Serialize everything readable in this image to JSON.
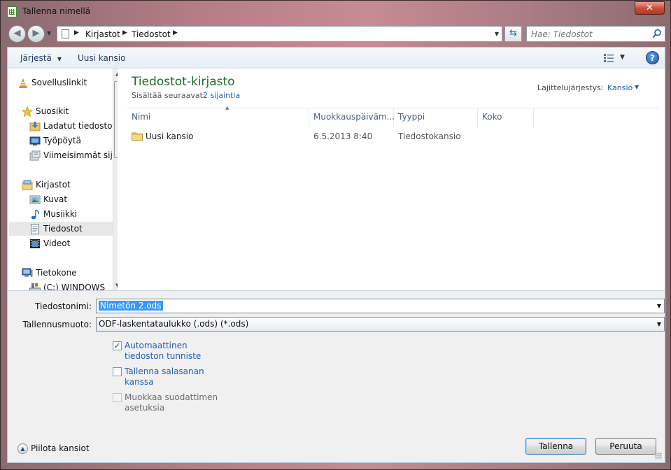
{
  "window": {
    "title": "Tallenna nimellä",
    "close_label": "✕"
  },
  "address": {
    "crumbs": [
      "Kirjastot",
      "Tiedostot"
    ],
    "search_placeholder": "Hae: Tiedostot"
  },
  "toolbar": {
    "organize_label": "Järjestä",
    "new_folder_label": "Uusi kansio"
  },
  "navpane": {
    "items": [
      {
        "label": "Sovelluslinkit",
        "icon": "vlc-cone-icon"
      },
      {
        "label": "Suosikit",
        "icon": "star-icon"
      },
      {
        "label": "Ladatut tiedostot",
        "icon": "downloads-icon"
      },
      {
        "label": "Työpöytä",
        "icon": "desktop-icon"
      },
      {
        "label": "Viimeisimmät sijainnit",
        "icon": "recent-places-icon"
      },
      {
        "label": "Kirjastot",
        "icon": "libraries-icon"
      },
      {
        "label": "Kuvat",
        "icon": "pictures-icon"
      },
      {
        "label": "Musiikki",
        "icon": "music-icon"
      },
      {
        "label": "Tiedostot",
        "icon": "documents-icon",
        "selected": true
      },
      {
        "label": "Videot",
        "icon": "videos-icon"
      },
      {
        "label": "Tietokone",
        "icon": "computer-icon"
      },
      {
        "label": "(C:) WINDOWS",
        "icon": "drive-icon"
      }
    ]
  },
  "library": {
    "title": "Tiedostot-kirjasto",
    "includes_label": "Sisältää seuraavat:",
    "includes_link": "2 sijaintia",
    "sort_label": "Lajittelujärjestys:",
    "sort_value": "Kansio"
  },
  "columns": [
    "Nimi",
    "Muokkauspäiväm...",
    "Tyyppi",
    "Koko"
  ],
  "files": [
    {
      "name": "Uusi kansio",
      "modified": "6.5.2013 8:40",
      "type": "Tiedostokansio",
      "size": ""
    }
  ],
  "form": {
    "filename_label": "Tiedostonimi:",
    "filename_value": "Nimetön 2.ods",
    "format_label": "Tallennusmuoto:",
    "format_value": "ODF-laskentataulukko (.ods) (*.ods)",
    "options": [
      {
        "label": "Automaattinen\ntiedoston tunniste",
        "checked": true,
        "enabled": true
      },
      {
        "label": "Tallenna salasanan\nkanssa",
        "checked": false,
        "enabled": true
      },
      {
        "label": "Muokkaa suodattimen\nasetuksia",
        "checked": false,
        "enabled": false
      }
    ],
    "hide_folders_label": "Piilota kansiot",
    "save_label": "Tallenna",
    "cancel_label": "Peruuta"
  }
}
